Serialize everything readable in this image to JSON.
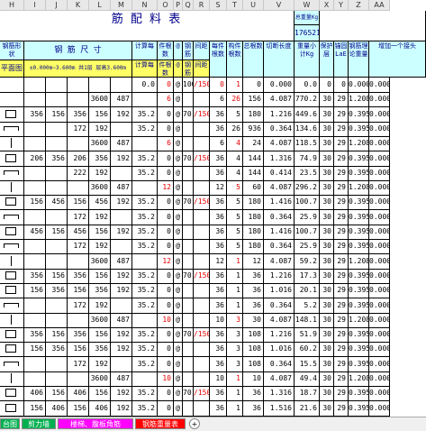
{
  "columns": [
    "H",
    "I",
    "J",
    "K",
    "L",
    "M",
    "N",
    "O",
    "P",
    "Q",
    "R",
    "S",
    "T",
    "U",
    "V",
    "W",
    "X",
    "Y",
    "Z",
    "AA"
  ],
  "title": "筋   配   料   表",
  "total_weight_label": "总重量Kg",
  "total_weight_value": "176521",
  "header_row2": {
    "shape": "钢筋形状",
    "dims": "钢     筋     尺     寸",
    "calc_count": "计算每",
    "piece_count": "件根数",
    "at": "@",
    "spacing1": "钢筋",
    "spacing2": "间距",
    "each_count": "每件根数",
    "build_count": "构件根数",
    "total_count": "总根数",
    "cut_length": "切断长度",
    "weight_subtotal": "重量小计Kg",
    "cover": "保护层",
    "anchor": "锚固LaE",
    "lap": "钢筋理论重量",
    "extra": "增加一个接头"
  },
  "header_row3": {
    "plan": "平面图",
    "levels": "±0.000m~3.600m  共1层  层高3.600m",
    "calc_count": "计算每",
    "piece_count": "件根数",
    "at": "@",
    "spacing1": "钢筋",
    "spacing2": "间距"
  },
  "rows": [
    {
      "h": "",
      "i": "",
      "j": "",
      "k": "",
      "l": "",
      "m": "",
      "n": "0.0",
      "o": "0",
      "p": "@",
      "q": "100",
      "r": "/150",
      "s": "0",
      "t": "1",
      "u": "0",
      "v": "0.000",
      "w": "0.0",
      "x": "0",
      "y": "0",
      "z": "0.000",
      "aa": "0.000",
      "red": [
        "o",
        "r",
        "s",
        "t"
      ]
    },
    {
      "h": "",
      "i": "",
      "j": "",
      "k": "",
      "l": "3600",
      "m": "487",
      "n": "",
      "o": "6",
      "p": "@",
      "q": "",
      "r": "",
      "s": "6",
      "t": "26",
      "u": "156",
      "v": "4.087",
      "w": "770.2",
      "x": "30",
      "y": "29",
      "z": "1.208",
      "aa": "0.000",
      "red": [
        "o",
        "t"
      ]
    },
    {
      "h": "shape-box",
      "i": "356",
      "j": "156",
      "k": "356",
      "l": "156",
      "m": "192",
      "n": "35.2",
      "o": "0",
      "p": "@",
      "q": "70",
      "r": "/150",
      "s": "36",
      "t": "5",
      "u": "180",
      "v": "1.216",
      "w": "449.6",
      "x": "30",
      "y": "29",
      "z": "0.395",
      "aa": "0.000",
      "red": [
        "r"
      ]
    },
    {
      "h": "shape-hook",
      "i": "",
      "j": "",
      "k": "172",
      "l": "192",
      "m": "",
      "n": "35.2",
      "o": "0",
      "p": "@",
      "q": "",
      "r": "",
      "s": "36",
      "t": "26",
      "u": "936",
      "v": "0.364",
      "w": "134.6",
      "x": "30",
      "y": "29",
      "z": "0.395",
      "aa": "0.000",
      "red": []
    },
    {
      "h": "shape-bar",
      "i": "",
      "j": "",
      "k": "",
      "l": "3600",
      "m": "487",
      "n": "",
      "o": "6",
      "p": "@",
      "q": "",
      "r": "",
      "s": "6",
      "t": "4",
      "u": "24",
      "v": "4.087",
      "w": "118.5",
      "x": "30",
      "y": "29",
      "z": "1.208",
      "aa": "0.000",
      "red": [
        "o",
        "t"
      ]
    },
    {
      "h": "shape-box",
      "i": "206",
      "j": "356",
      "k": "206",
      "l": "356",
      "m": "192",
      "n": "35.2",
      "o": "0",
      "p": "@",
      "q": "70",
      "r": "/150",
      "s": "36",
      "t": "4",
      "u": "144",
      "v": "1.316",
      "w": "74.9",
      "x": "30",
      "y": "29",
      "z": "0.395",
      "aa": "0.000",
      "red": [
        "r"
      ]
    },
    {
      "h": "shape-hook",
      "i": "",
      "j": "",
      "k": "222",
      "l": "192",
      "m": "",
      "n": "35.2",
      "o": "0",
      "p": "@",
      "q": "",
      "r": "",
      "s": "36",
      "t": "4",
      "u": "144",
      "v": "0.414",
      "w": "23.5",
      "x": "30",
      "y": "29",
      "z": "0.395",
      "aa": "0.000",
      "red": []
    },
    {
      "h": "shape-bar",
      "i": "",
      "j": "",
      "k": "",
      "l": "3600",
      "m": "487",
      "n": "",
      "o": "12",
      "p": "@",
      "q": "",
      "r": "",
      "s": "12",
      "t": "5",
      "u": "60",
      "v": "4.087",
      "w": "296.2",
      "x": "30",
      "y": "29",
      "z": "1.208",
      "aa": "0.000",
      "red": [
        "o",
        "t"
      ]
    },
    {
      "h": "shape-box",
      "i": "156",
      "j": "456",
      "k": "156",
      "l": "456",
      "m": "192",
      "n": "35.2",
      "o": "0",
      "p": "@",
      "q": "70",
      "r": "/150",
      "s": "36",
      "t": "5",
      "u": "180",
      "v": "1.416",
      "w": "100.7",
      "x": "30",
      "y": "29",
      "z": "0.395",
      "aa": "0.000",
      "red": [
        "r"
      ]
    },
    {
      "h": "shape-hook",
      "i": "",
      "j": "",
      "k": "172",
      "l": "192",
      "m": "",
      "n": "35.2",
      "o": "0",
      "p": "@",
      "q": "",
      "r": "",
      "s": "36",
      "t": "5",
      "u": "180",
      "v": "0.364",
      "w": "25.9",
      "x": "30",
      "y": "29",
      "z": "0.395",
      "aa": "0.000",
      "red": []
    },
    {
      "h": "shape-box",
      "i": "456",
      "j": "156",
      "k": "456",
      "l": "156",
      "m": "192",
      "n": "35.2",
      "o": "0",
      "p": "@",
      "q": "",
      "r": "",
      "s": "36",
      "t": "5",
      "u": "180",
      "v": "1.416",
      "w": "100.7",
      "x": "30",
      "y": "29",
      "z": "0.395",
      "aa": "0.000",
      "red": []
    },
    {
      "h": "shape-hook",
      "i": "",
      "j": "",
      "k": "172",
      "l": "192",
      "m": "",
      "n": "35.2",
      "o": "0",
      "p": "@",
      "q": "",
      "r": "",
      "s": "36",
      "t": "5",
      "u": "180",
      "v": "0.364",
      "w": "25.9",
      "x": "30",
      "y": "29",
      "z": "0.395",
      "aa": "0.000",
      "red": []
    },
    {
      "h": "shape-bar",
      "i": "",
      "j": "",
      "k": "",
      "l": "3600",
      "m": "487",
      "n": "",
      "o": "12",
      "p": "@",
      "q": "",
      "r": "",
      "s": "12",
      "t": "1",
      "u": "12",
      "v": "4.087",
      "w": "59.2",
      "x": "30",
      "y": "29",
      "z": "1.208",
      "aa": "0.000",
      "red": [
        "o",
        "t"
      ]
    },
    {
      "h": "shape-box",
      "i": "356",
      "j": "156",
      "k": "356",
      "l": "156",
      "m": "192",
      "n": "35.2",
      "o": "0",
      "p": "@",
      "q": "70",
      "r": "/150",
      "s": "36",
      "t": "1",
      "u": "36",
      "v": "1.216",
      "w": "17.3",
      "x": "30",
      "y": "29",
      "z": "0.395",
      "aa": "0.000",
      "red": [
        "r"
      ]
    },
    {
      "h": "shape-box",
      "i": "156",
      "j": "356",
      "k": "156",
      "l": "356",
      "m": "192",
      "n": "35.2",
      "o": "0",
      "p": "@",
      "q": "",
      "r": "",
      "s": "36",
      "t": "1",
      "u": "36",
      "v": "1.016",
      "w": "20.1",
      "x": "30",
      "y": "29",
      "z": "0.395",
      "aa": "0.000",
      "red": []
    },
    {
      "h": "shape-hook",
      "i": "",
      "j": "",
      "k": "172",
      "l": "192",
      "m": "",
      "n": "35.2",
      "o": "0",
      "p": "@",
      "q": "",
      "r": "",
      "s": "36",
      "t": "1",
      "u": "36",
      "v": "0.364",
      "w": "5.2",
      "x": "30",
      "y": "29",
      "z": "0.395",
      "aa": "0.000",
      "red": []
    },
    {
      "h": "shape-bar",
      "i": "",
      "j": "",
      "k": "",
      "l": "3600",
      "m": "487",
      "n": "",
      "o": "10",
      "p": "@",
      "q": "",
      "r": "",
      "s": "10",
      "t": "3",
      "u": "30",
      "v": "4.087",
      "w": "148.1",
      "x": "30",
      "y": "29",
      "z": "1.208",
      "aa": "0.000",
      "red": [
        "o",
        "t"
      ]
    },
    {
      "h": "shape-box",
      "i": "356",
      "j": "156",
      "k": "356",
      "l": "156",
      "m": "192",
      "n": "35.2",
      "o": "0",
      "p": "@",
      "q": "70",
      "r": "/150",
      "s": "36",
      "t": "3",
      "u": "108",
      "v": "1.216",
      "w": "51.9",
      "x": "30",
      "y": "29",
      "z": "0.395",
      "aa": "0.000",
      "red": [
        "r"
      ]
    },
    {
      "h": "shape-box",
      "i": "156",
      "j": "356",
      "k": "156",
      "l": "356",
      "m": "192",
      "n": "35.2",
      "o": "0",
      "p": "@",
      "q": "",
      "r": "",
      "s": "36",
      "t": "3",
      "u": "108",
      "v": "1.016",
      "w": "60.2",
      "x": "30",
      "y": "29",
      "z": "0.395",
      "aa": "0.000",
      "red": []
    },
    {
      "h": "shape-hook",
      "i": "",
      "j": "",
      "k": "172",
      "l": "192",
      "m": "",
      "n": "35.2",
      "o": "0",
      "p": "@",
      "q": "",
      "r": "",
      "s": "36",
      "t": "3",
      "u": "108",
      "v": "0.364",
      "w": "15.5",
      "x": "30",
      "y": "29",
      "z": "0.395",
      "aa": "0.000",
      "red": []
    },
    {
      "h": "shape-bar",
      "i": "",
      "j": "",
      "k": "",
      "l": "3600",
      "m": "487",
      "n": "",
      "o": "10",
      "p": "@",
      "q": "",
      "r": "",
      "s": "10",
      "t": "1",
      "u": "10",
      "v": "4.087",
      "w": "49.4",
      "x": "30",
      "y": "29",
      "z": "1.208",
      "aa": "0.000",
      "red": [
        "o",
        "t"
      ]
    },
    {
      "h": "shape-box",
      "i": "406",
      "j": "156",
      "k": "406",
      "l": "156",
      "m": "192",
      "n": "35.2",
      "o": "0",
      "p": "@",
      "q": "70",
      "r": "/150",
      "s": "36",
      "t": "1",
      "u": "36",
      "v": "1.316",
      "w": "18.7",
      "x": "30",
      "y": "29",
      "z": "0.395",
      "aa": "0.000",
      "red": [
        "r"
      ]
    },
    {
      "h": "shape-box",
      "i": "156",
      "j": "406",
      "k": "156",
      "l": "406",
      "m": "192",
      "n": "35.2",
      "o": "0",
      "p": "@",
      "q": "",
      "r": "",
      "s": "36",
      "t": "1",
      "u": "36",
      "v": "1.516",
      "w": "21.6",
      "x": "30",
      "y": "29",
      "z": "0.395",
      "aa": "0.000",
      "red": []
    }
  ],
  "tabs": [
    {
      "label": "台图",
      "bg": "#00b050",
      "color": "#fff"
    },
    {
      "label": "剪力墙",
      "bg": "#00b050",
      "color": "#fff"
    },
    {
      "label": "楼梯、腹板角筋",
      "bg": "#ff00ff",
      "color": "#fff"
    },
    {
      "label": "钢筋重量表",
      "bg": "#ff0000",
      "color": "#fff"
    }
  ],
  "add_sheet": "+",
  "colors": {
    "header_cyan": "#ccffff",
    "header_yellow": "#ffff66",
    "red": "#e60000"
  }
}
